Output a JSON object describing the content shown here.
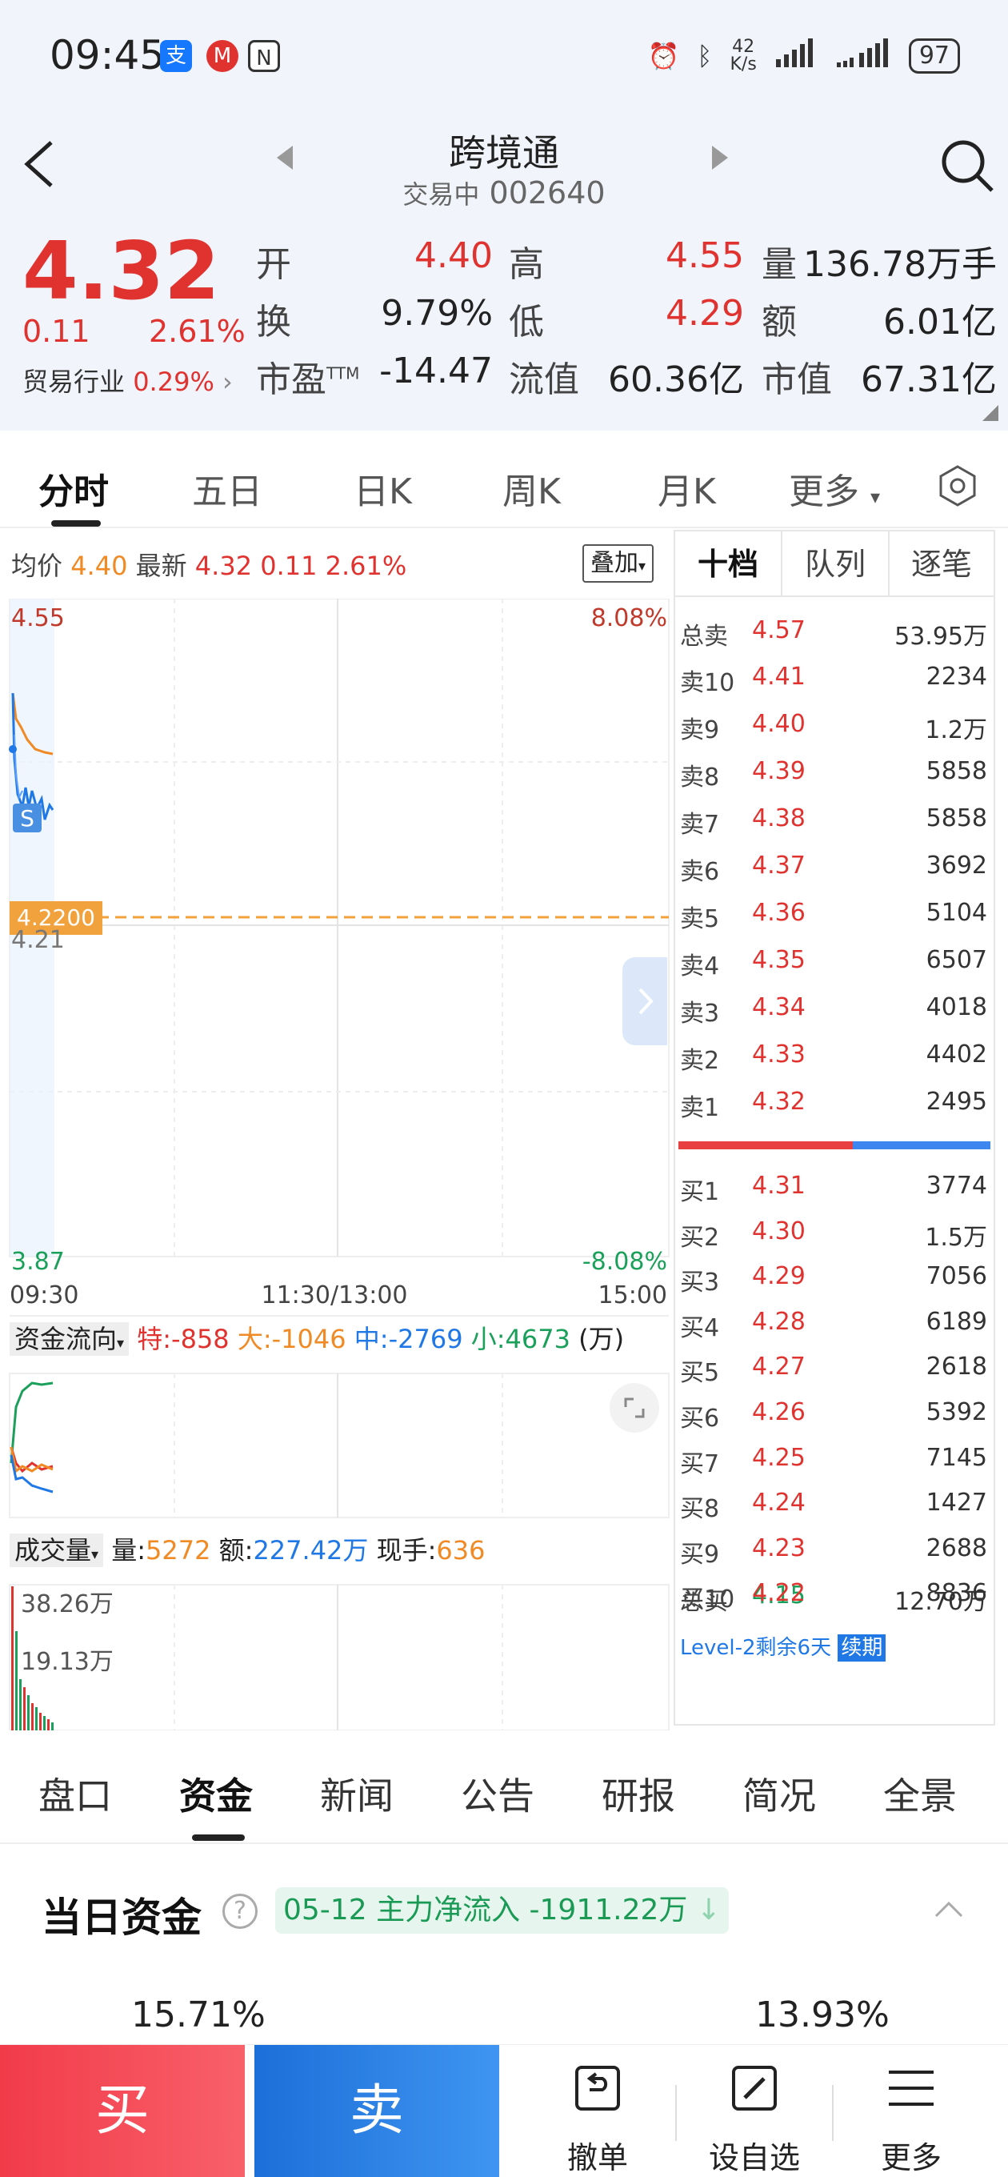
{
  "status_bar": {
    "time": "09:45",
    "icons": [
      "alipay-icon",
      "cmb-icon",
      "nfc-icon"
    ],
    "net_speed_value": "42",
    "net_speed_unit": "K/s",
    "battery": "97"
  },
  "header": {
    "name": "跨境通",
    "status": "交易中",
    "code": "002640"
  },
  "quote": {
    "price": "4.32",
    "change": "0.11",
    "change_pct": "2.61%",
    "industry_label": "贸易行业",
    "industry_pct": "0.29%",
    "fields": [
      {
        "label": "开",
        "value": "4.40",
        "color": "red"
      },
      {
        "label": "高",
        "value": "4.55",
        "color": "red"
      },
      {
        "label": "量",
        "value": "136.78万手",
        "color": "black"
      },
      {
        "label": "换",
        "value": "9.79%",
        "color": "black"
      },
      {
        "label": "低",
        "value": "4.29",
        "color": "red"
      },
      {
        "label": "额",
        "value": "6.01亿",
        "color": "black"
      },
      {
        "label": "市盈TTM",
        "value": "-14.47",
        "color": "black"
      },
      {
        "label": "流值",
        "value": "60.36亿",
        "color": "black"
      },
      {
        "label": "市值",
        "value": "67.31亿",
        "color": "black"
      }
    ]
  },
  "period_tabs": [
    "分时",
    "五日",
    "日K",
    "周K",
    "月K",
    "更多"
  ],
  "chart": {
    "avg_label": "均价",
    "avg_value": "4.40",
    "latest_label": "最新",
    "latest_value": "4.32",
    "latest_change": "0.11",
    "latest_pct": "2.61%",
    "overlay_label": "叠加",
    "y_top": "4.55",
    "y_top_pct": "8.08%",
    "y_bottom": "3.87",
    "y_bottom_pct": "-8.08%",
    "y_mid": "4.21",
    "marker_price": "4.2200",
    "s_marker": "S",
    "x_start": "09:30",
    "x_mid": "11:30/13:00",
    "x_end": "15:00"
  },
  "fund_flow": {
    "label": "资金流向",
    "te_label": "特:",
    "te_value": "-858",
    "da_label": "大:",
    "da_value": "-1046",
    "zhong_label": "中:",
    "zhong_value": "-2769",
    "xiao_label": "小:",
    "xiao_value": "4673",
    "unit": "(万)"
  },
  "volume": {
    "label": "成交量",
    "vol_label": "量:",
    "vol_value": "5272",
    "amt_label": "额:",
    "amt_value": "227.42万",
    "hand_label": "现手:",
    "hand_value": "636",
    "y_top": "38.26万",
    "y_mid": "19.13万"
  },
  "order_book": {
    "tabs": [
      "十档",
      "队列",
      "逐笔"
    ],
    "total_sell": {
      "label": "总卖",
      "price": "4.57",
      "vol": "53.95万"
    },
    "asks": [
      {
        "label": "卖10",
        "price": "4.41",
        "vol": "2234"
      },
      {
        "label": "卖9",
        "price": "4.40",
        "vol": "1.2万"
      },
      {
        "label": "卖8",
        "price": "4.39",
        "vol": "5858"
      },
      {
        "label": "卖7",
        "price": "4.38",
        "vol": "5858"
      },
      {
        "label": "卖6",
        "price": "4.37",
        "vol": "3692"
      },
      {
        "label": "卖5",
        "price": "4.36",
        "vol": "5104"
      },
      {
        "label": "卖4",
        "price": "4.35",
        "vol": "6507"
      },
      {
        "label": "卖3",
        "price": "4.34",
        "vol": "4018"
      },
      {
        "label": "卖2",
        "price": "4.33",
        "vol": "4402"
      },
      {
        "label": "卖1",
        "price": "4.32",
        "vol": "2495"
      }
    ],
    "bids": [
      {
        "label": "买1",
        "price": "4.31",
        "vol": "3774"
      },
      {
        "label": "买2",
        "price": "4.30",
        "vol": "1.5万"
      },
      {
        "label": "买3",
        "price": "4.29",
        "vol": "7056"
      },
      {
        "label": "买4",
        "price": "4.28",
        "vol": "6189"
      },
      {
        "label": "买5",
        "price": "4.27",
        "vol": "2618"
      },
      {
        "label": "买6",
        "price": "4.26",
        "vol": "5392"
      },
      {
        "label": "买7",
        "price": "4.25",
        "vol": "7145"
      },
      {
        "label": "买8",
        "price": "4.24",
        "vol": "1427"
      },
      {
        "label": "买9",
        "price": "4.23",
        "vol": "2688"
      },
      {
        "label": "买10",
        "price": "4.22",
        "vol": "8836"
      }
    ],
    "total_buy": {
      "label": "总买",
      "price": "4.15",
      "vol": "12.70万"
    },
    "level2_text": "Level-2剩余6天",
    "renew_label": "续期"
  },
  "bottom_tabs": [
    "盘口",
    "资金",
    "新闻",
    "公告",
    "研报",
    "简况",
    "全景"
  ],
  "funds": {
    "title": "当日资金",
    "banner_date": "05-12",
    "banner_text": "主力净流入",
    "banner_value": "-1911.22万",
    "pct_left": "15.71%",
    "pct_right": "13.93%"
  },
  "actions": {
    "buy": "买",
    "sell": "卖",
    "cancel": "撤单",
    "watchlist": "设自选",
    "more": "更多"
  }
}
